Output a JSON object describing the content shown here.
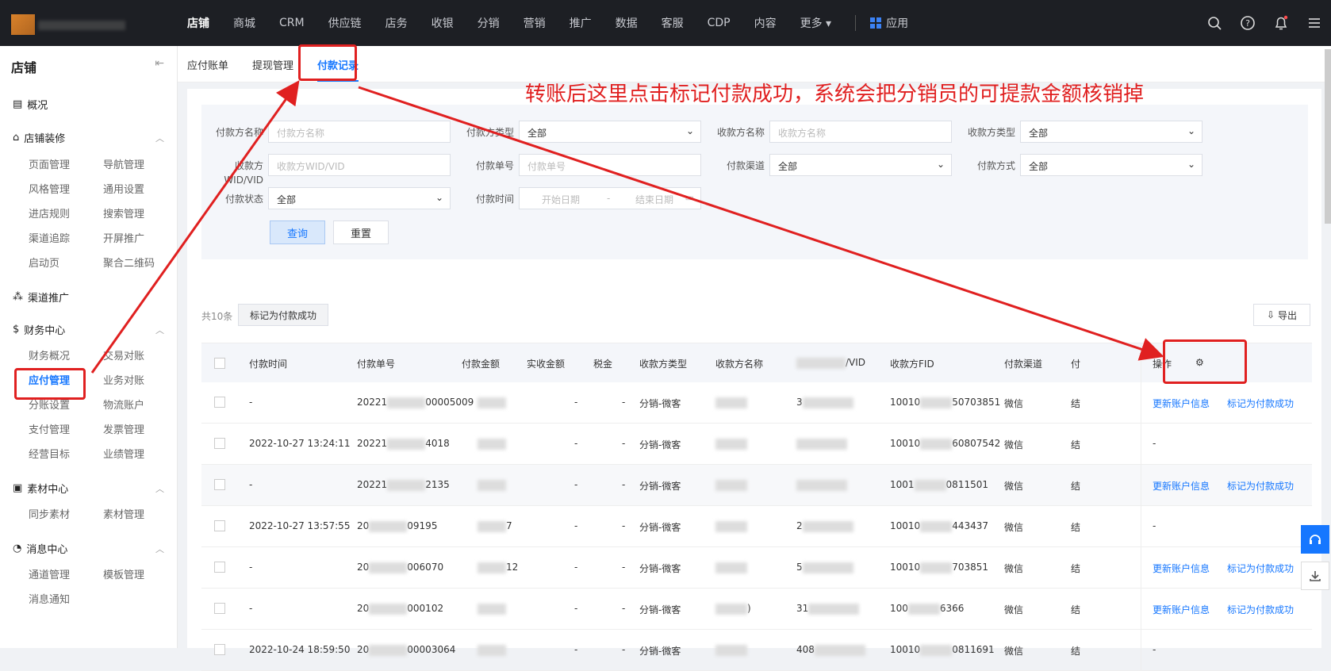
{
  "topnav": {
    "items": [
      "店铺",
      "商城",
      "CRM",
      "供应链",
      "店务",
      "收银",
      "分销",
      "营销",
      "推广",
      "数据",
      "客服",
      "CDP",
      "内容"
    ],
    "more": "更多 ▾",
    "apps": "应用"
  },
  "sidebar": {
    "title": "店铺",
    "overview": "概况",
    "decor": "店铺装修",
    "decor_items": [
      "页面管理",
      "导航管理",
      "风格管理",
      "通用设置",
      "进店规则",
      "搜索管理",
      "渠道追踪",
      "开屏推广",
      "启动页",
      "聚合二维码"
    ],
    "channel": "渠道推广",
    "finance": "财务中心",
    "finance_items": [
      "财务概况",
      "交易对账",
      "应付管理",
      "业务对账",
      "分账设置",
      "物流账户",
      "支付管理",
      "发票管理",
      "经营目标",
      "业绩管理"
    ],
    "material": "素材中心",
    "material_items": [
      "同步素材",
      "素材管理"
    ],
    "message": "消息中心",
    "message_items": [
      "通道管理",
      "模板管理",
      "消息通知"
    ]
  },
  "tabs": [
    "应付账单",
    "提现管理",
    "付款记录"
  ],
  "annotation": "转账后这里点击标记付款成功，系统会把分销员的可提款金额核销掉",
  "filters": {
    "payer_name_label": "付款方名称",
    "payer_name_ph": "付款方名称",
    "payer_type_label": "付款方类型",
    "payer_type_val": "全部",
    "payee_name_label": "收款方名称",
    "payee_name_ph": "收款方名称",
    "payee_type_label": "收款方类型",
    "payee_type_val": "全部",
    "payee_wid_label_1": "收款方",
    "payee_wid_label_2": "WID/VID",
    "payee_wid_ph": "收款方WID/VID",
    "order_no_label": "付款单号",
    "order_no_ph": "付款单号",
    "channel_label": "付款渠道",
    "channel_val": "全部",
    "method_label": "付款方式",
    "method_val": "全部",
    "status_label": "付款状态",
    "status_val": "全部",
    "time_label": "付款时间",
    "start_ph": "开始日期",
    "range_sep": "-",
    "end_ph": "结束日期",
    "query": "查询",
    "reset": "重置"
  },
  "toolbar": {
    "total": "共10条",
    "mark_btn": "标记为付款成功",
    "export": "导出"
  },
  "table": {
    "headers": [
      "付款时间",
      "付款单号",
      "付款金额",
      "实收金额",
      "税金",
      "收款方类型",
      "收款方名称",
      "/VID",
      "收款方FID",
      "付款渠道",
      "付",
      "操作"
    ],
    "rows": [
      {
        "time": "-",
        "no_a": "20221",
        "no_b": "00005009",
        "real": "-",
        "tax": "-",
        "type": "分销-微客",
        "wid": "3",
        "fid_a": "10010",
        "fid_b": "50703851",
        "channel": "微信",
        "ops": true
      },
      {
        "time": "2022-10-27 13:24:11",
        "no_a": "20221",
        "no_b": "4018",
        "real": "-",
        "tax": "-",
        "type": "分销-微客",
        "wid": "",
        "fid_a": "10010",
        "fid_b": "60807542",
        "channel": "微信",
        "ops": false
      },
      {
        "time": "-",
        "no_a": "20221",
        "no_b": "2135",
        "real": "-",
        "tax": "-",
        "type": "分销-微客",
        "wid": "",
        "fid_a": "1001",
        "fid_b": "0811501",
        "channel": "微信",
        "ops": true
      },
      {
        "time": "2022-10-27 13:57:55",
        "no_a": "20",
        "no_b": "09195",
        "amount": "7",
        "real": "-",
        "tax": "-",
        "type": "分销-微客",
        "wid": "2",
        "fid_a": "10010",
        "fid_b": "443437",
        "channel": "微信",
        "ops": false
      },
      {
        "time": "-",
        "no_a": "20",
        "no_b": "006070",
        "amount": "12",
        "real": "-",
        "tax": "-",
        "type": "分销-微客",
        "wid": "5",
        "fid_a": "10010",
        "fid_b": "703851",
        "channel": "微信",
        "ops": true
      },
      {
        "time": "-",
        "no_a": "20",
        "no_b": "000102",
        "real": "-",
        "tax": "-",
        "type": "分销-微客",
        "name_tail": ")",
        "wid": "31",
        "fid_a": "100",
        "fid_b": "6366",
        "channel": "微信",
        "ops": true
      },
      {
        "time": "2022-10-24 18:59:50",
        "no_a": "20",
        "no_b": "00003064",
        "real": "-",
        "tax": "-",
        "type": "分销-微客",
        "wid": "408",
        "fid_a": "10010",
        "fid_b": "0811691",
        "channel": "微信",
        "ops": false
      }
    ],
    "op_update": "更新账户信息",
    "op_mark": "标记为付款成功",
    "op_none": "-",
    "trunc_col": "结"
  },
  "colors": {
    "accent": "#1677ff",
    "annotation": "#e02020",
    "topbar": "#1d1f24"
  }
}
